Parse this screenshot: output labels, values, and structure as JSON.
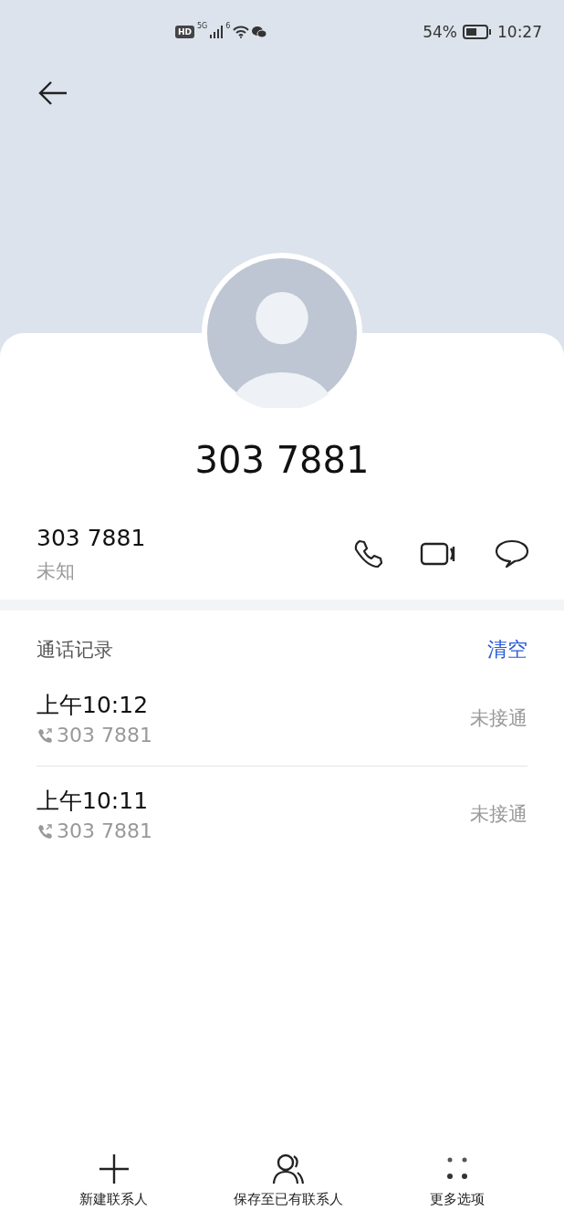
{
  "status_bar": {
    "hd_badge": "HD",
    "network": "5G",
    "wifi_tag": "6",
    "battery_percent": "54%",
    "time": "10:27"
  },
  "contact": {
    "title": "303 7881",
    "number": "303 7881",
    "label": "未知"
  },
  "call_log": {
    "title": "通话记录",
    "clear": "清空",
    "entries": [
      {
        "time": "上午10:12",
        "number": "303 7881",
        "status": "未接通"
      },
      {
        "time": "上午10:11",
        "number": "303 7881",
        "status": "未接通"
      }
    ]
  },
  "bottom_actions": [
    {
      "kind": "add",
      "label": "新建联系人"
    },
    {
      "kind": "person",
      "label": "保存至已有联系人"
    },
    {
      "kind": "more",
      "label": "更多选项"
    }
  ]
}
